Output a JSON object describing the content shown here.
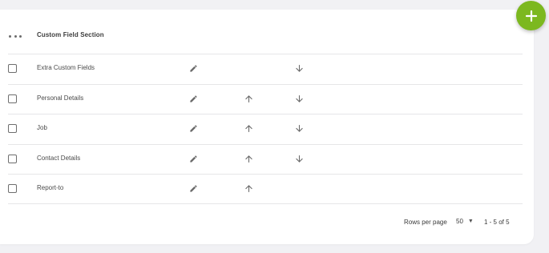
{
  "add_button": {
    "icon": "plus-icon",
    "color": "#7cb81f"
  },
  "table": {
    "header": {
      "menu_icon": "more-horizontal-icon",
      "column_label": "Custom Field Section"
    },
    "rows": [
      {
        "label": "Extra Custom Fields",
        "can_move_up": false,
        "can_move_down": true
      },
      {
        "label": "Personal Details",
        "can_move_up": true,
        "can_move_down": true
      },
      {
        "label": "Job",
        "can_move_up": true,
        "can_move_down": true
      },
      {
        "label": "Contact Details",
        "can_move_up": true,
        "can_move_down": true
      },
      {
        "label": "Report-to",
        "can_move_up": true,
        "can_move_down": false
      }
    ]
  },
  "pagination": {
    "rows_per_page_label": "Rows per page",
    "rows_per_page_value": "50",
    "range_label": "1 - 5 of 5"
  }
}
